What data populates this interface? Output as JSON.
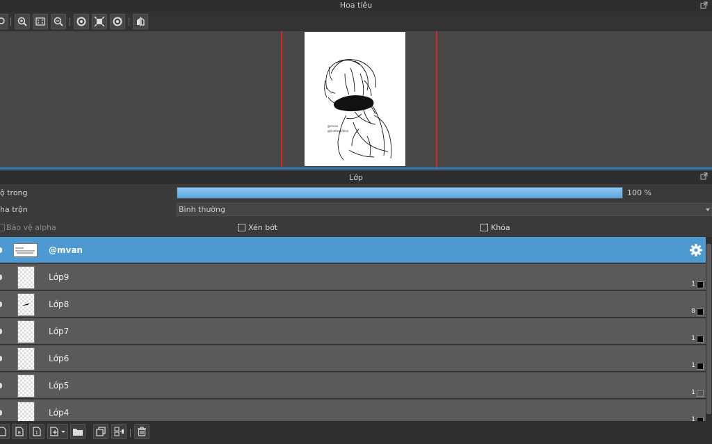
{
  "navigator": {
    "title": "Hoa tiêu",
    "toolbar_icons": [
      "magnify-icon",
      "zoom-in-icon",
      "fit-screen-icon",
      "zoom-out-icon",
      "rotate-left-icon",
      "reset-view-icon",
      "rotate-right-icon",
      "flip-icon"
    ]
  },
  "layer_panel": {
    "title": "Lớp",
    "opacity_label": "ộ trong",
    "opacity_percent": 100,
    "opacity_value": "100 %",
    "blend_label": "ha trộn",
    "blend_value": "Bình thường",
    "protect_alpha_label": "Bảo vệ alpha",
    "clipping_label": "Xén bớt",
    "lock_label": "Khóa",
    "layers": [
      {
        "name": "@mvan",
        "selected": true,
        "count": "",
        "swatch": ""
      },
      {
        "name": "Lớp9",
        "selected": false,
        "count": "1",
        "swatch": "#000000"
      },
      {
        "name": "Lớp8",
        "selected": false,
        "count": "8",
        "swatch": "#000000"
      },
      {
        "name": "Lớp7",
        "selected": false,
        "count": "1",
        "swatch": "#000000"
      },
      {
        "name": "Lớp6",
        "selected": false,
        "count": "1",
        "swatch": "#000000"
      },
      {
        "name": "Lớp5",
        "selected": false,
        "count": "1",
        "swatch": "#555555"
      },
      {
        "name": "Lớp4",
        "selected": false,
        "count": "1",
        "swatch": "#000000"
      }
    ]
  },
  "bottom_toolbar_icons": [
    "new-layer-icon",
    "new-8bit-layer-icon",
    "new-1bit-layer-icon",
    "add-layer-dropdown-icon",
    "folder-icon",
    "duplicate-layer-icon",
    "merge-layer-icon",
    "delete-layer-icon"
  ],
  "colors": {
    "accent": "#4d9ad1",
    "divider": "#2b7fbf",
    "canvas_border": "#d42828"
  }
}
